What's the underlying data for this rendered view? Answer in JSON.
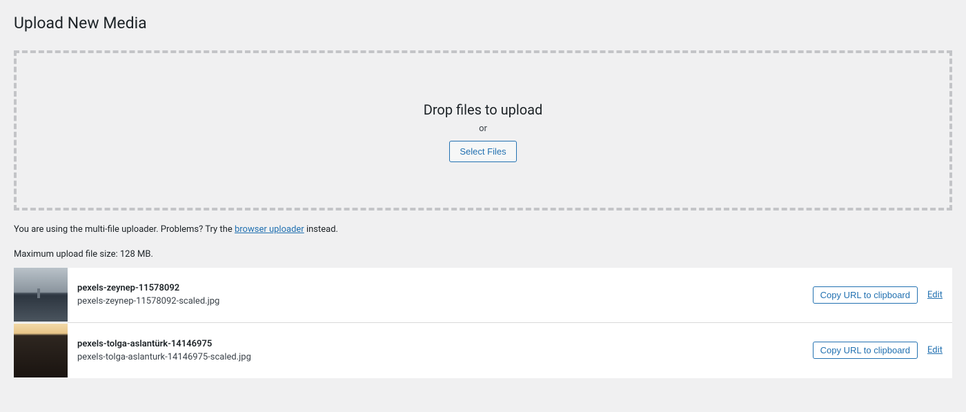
{
  "page_title": "Upload New Media",
  "dropzone": {
    "drop_text": "Drop files to upload",
    "or_text": "or",
    "select_button": "Select Files"
  },
  "uploader_note": {
    "prefix": "You are using the multi-file uploader. Problems? Try the ",
    "link_text": "browser uploader",
    "suffix": " instead."
  },
  "max_size_text": "Maximum upload file size: 128 MB.",
  "actions": {
    "copy_label": "Copy URL to clipboard",
    "edit_label": "Edit"
  },
  "items": [
    {
      "title": "pexels-zeynep-11578092",
      "filename": "pexels-zeynep-11578092-scaled.jpg"
    },
    {
      "title": "pexels-tolga-aslantürk-14146975",
      "filename": "pexels-tolga-aslanturk-14146975-scaled.jpg"
    }
  ]
}
